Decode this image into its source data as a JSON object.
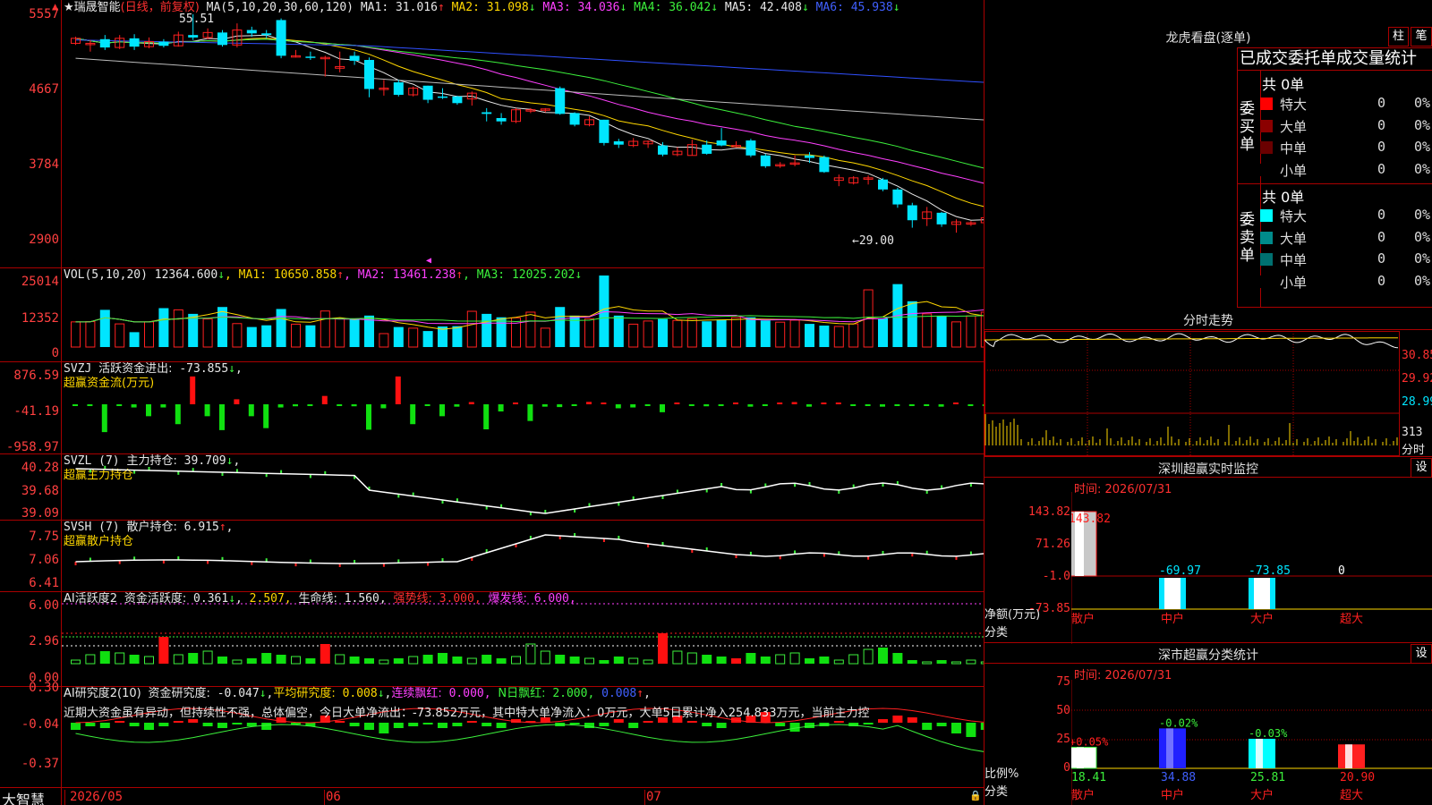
{
  "stock": {
    "name": "★瑞晟智能",
    "period": "(日线，前复权)"
  },
  "main_chart": {
    "ma_label": "MA(5,10,20,30,60,120)",
    "ma": [
      {
        "name": "MA1:",
        "value": "31.016",
        "arrow": "↑",
        "color": "#e8e8e8"
      },
      {
        "name": "MA2:",
        "value": "31.098",
        "arrow": "↓",
        "color": "#ffd700"
      },
      {
        "name": "MA3:",
        "value": "34.036",
        "arrow": "↓",
        "color": "#ff40ff"
      },
      {
        "name": "MA4:",
        "value": "36.042",
        "arrow": "↓",
        "color": "#3cf13c"
      },
      {
        "name": "MA5:",
        "value": "42.408",
        "arrow": "↓",
        "color": "#e8e8e8"
      },
      {
        "name": "MA6:",
        "value": "45.938",
        "arrow": "↓",
        "color": "#4060ff"
      }
    ],
    "y_labels": [
      "5557",
      "4667",
      "3784",
      "2900"
    ],
    "high_marker": "55.51",
    "low_marker": "←29.00",
    "candles": [
      [
        52.0,
        52.6,
        51.8,
        52.8,
        1
      ],
      [
        52.0,
        52.0,
        51.0,
        52.4,
        1
      ],
      [
        52.5,
        51.5,
        51.2,
        53.0,
        0
      ],
      [
        51.5,
        52.6,
        51.3,
        53.0,
        1
      ],
      [
        52.6,
        51.6,
        51.2,
        53.1,
        0
      ],
      [
        51.6,
        52.2,
        51.4,
        52.7,
        1
      ],
      [
        52.2,
        51.7,
        51.5,
        52.5,
        0
      ],
      [
        51.7,
        53.0,
        51.6,
        53.4,
        1
      ],
      [
        53.0,
        52.7,
        52.4,
        55.5,
        0
      ],
      [
        52.7,
        53.3,
        52.5,
        53.8,
        1
      ],
      [
        53.3,
        51.8,
        51.6,
        53.6,
        0
      ],
      [
        51.8,
        53.6,
        51.5,
        54.4,
        1
      ],
      [
        53.6,
        53.2,
        52.8,
        54.0,
        0
      ],
      [
        53.2,
        53.0,
        52.6,
        53.6,
        0
      ],
      [
        54.8,
        50.5,
        50.2,
        55.0,
        0
      ],
      [
        50.5,
        50.5,
        50.3,
        51.2,
        1
      ],
      [
        50.4,
        50.3,
        50.0,
        51.0,
        0
      ],
      [
        50.3,
        50.3,
        48.0,
        50.5,
        1
      ],
      [
        49.2,
        49.0,
        48.5,
        51.0,
        1
      ],
      [
        50.5,
        49.9,
        49.4,
        51.0,
        0
      ],
      [
        50.0,
        46.5,
        45.5,
        50.3,
        0
      ],
      [
        46.5,
        46.6,
        45.7,
        47.6,
        1
      ],
      [
        47.3,
        45.8,
        45.6,
        47.6,
        0
      ],
      [
        45.8,
        46.6,
        45.6,
        46.8,
        1
      ],
      [
        46.9,
        45.2,
        44.8,
        46.9,
        0
      ],
      [
        45.6,
        45.6,
        45.3,
        46.6,
        0
      ],
      [
        45.6,
        44.8,
        44.6,
        45.7,
        0
      ],
      [
        45.3,
        46.0,
        44.5,
        46.2,
        1
      ],
      [
        43.5,
        43.7,
        42.6,
        44.2,
        0
      ],
      [
        43.0,
        42.6,
        42.2,
        43.6,
        0
      ],
      [
        42.6,
        44.0,
        42.4,
        44.2,
        1
      ],
      [
        44.0,
        44.0,
        43.6,
        44.2,
        1
      ],
      [
        44.0,
        44.1,
        43.7,
        44.2,
        1
      ],
      [
        46.6,
        43.5,
        43.4,
        46.8,
        0
      ],
      [
        43.6,
        42.2,
        42.0,
        43.7,
        0
      ],
      [
        42.2,
        42.8,
        42.0,
        43.2,
        1
      ],
      [
        42.8,
        40.0,
        39.7,
        42.8,
        0
      ],
      [
        40.2,
        39.8,
        39.4,
        40.5,
        0
      ],
      [
        39.7,
        40.2,
        39.5,
        40.6,
        1
      ],
      [
        40.2,
        39.9,
        39.4,
        40.3,
        1
      ],
      [
        39.7,
        38.6,
        38.4,
        40.1,
        0
      ],
      [
        38.6,
        39.0,
        38.4,
        39.5,
        1
      ],
      [
        38.5,
        39.8,
        38.5,
        40.4,
        1
      ],
      [
        39.8,
        38.7,
        38.6,
        40.3,
        0
      ],
      [
        40.3,
        39.7,
        39.6,
        41.8,
        0
      ],
      [
        39.7,
        39.6,
        39.5,
        40.2,
        1
      ],
      [
        40.3,
        38.5,
        38.3,
        40.5,
        0
      ],
      [
        38.5,
        37.2,
        37.0,
        38.7,
        0
      ],
      [
        37.3,
        37.4,
        37.0,
        37.7,
        1
      ],
      [
        37.5,
        37.6,
        37.2,
        38.5,
        1
      ],
      [
        38.5,
        38.2,
        37.6,
        38.9,
        0
      ],
      [
        38.3,
        36.5,
        36.4,
        38.5,
        0
      ],
      [
        35.8,
        35.5,
        34.8,
        36.2,
        1
      ],
      [
        35.2,
        35.8,
        35.0,
        36.0,
        1
      ],
      [
        35.8,
        35.7,
        35.0,
        36.1,
        1
      ],
      [
        35.6,
        34.4,
        34.2,
        35.8,
        0
      ],
      [
        34.4,
        32.6,
        32.2,
        34.6,
        0
      ],
      [
        32.5,
        30.7,
        29.8,
        32.8,
        0
      ],
      [
        30.9,
        31.7,
        30.0,
        32.3,
        1
      ],
      [
        31.6,
        30.2,
        29.9,
        31.7,
        0
      ],
      [
        30.2,
        30.5,
        29.2,
        30.8,
        1
      ],
      [
        30.4,
        30.4,
        30.0,
        30.6,
        1
      ],
      [
        30.4,
        31.0,
        30.2,
        31.3,
        1
      ],
      [
        31.0,
        30.7,
        30.4,
        31.1,
        1
      ],
      [
        30.7,
        30.8,
        30.5,
        32.3,
        0
      ],
      [
        30.8,
        31.0,
        30.4,
        31.3,
        1
      ],
      [
        30.8,
        30.6,
        30.4,
        31.1,
        1
      ],
      [
        30.6,
        29.8,
        29.4,
        30.8,
        0
      ],
      [
        30.3,
        31.4,
        30.2,
        31.6,
        0
      ]
    ]
  },
  "vol_panel": {
    "label": "VOL(5,10,20)",
    "value": "12364.600",
    "value_arrow": "↓",
    "ma": [
      {
        "name": "MA1:",
        "value": "10650.858",
        "arrow": "↑",
        "color": "#ffd700"
      },
      {
        "name": "MA2:",
        "value": "13461.238",
        "arrow": "↑",
        "color": "#ff40ff"
      },
      {
        "name": "MA3:",
        "value": "12025.202",
        "arrow": "↓",
        "color": "#3cf13c"
      }
    ],
    "y_labels": [
      "25014",
      "12352",
      "0"
    ],
    "volumes": [
      8800,
      8900,
      13000,
      8100,
      5200,
      8800,
      13600,
      13000,
      11600,
      9800,
      14000,
      8200,
      7000,
      7600,
      13300,
      8000,
      7600,
      12600,
      9900,
      10000,
      11000,
      4700,
      7000,
      6600,
      5600,
      7200,
      7300,
      12500,
      11600,
      10400,
      10200,
      12200,
      6600,
      14000,
      11000,
      9900,
      25000,
      11000,
      8000,
      9100,
      9800,
      9300,
      9900,
      9000,
      9600,
      10300,
      10400,
      9300,
      8700,
      9400,
      8100,
      7500,
      7200,
      8100,
      20000,
      10000,
      22000,
      16000,
      11600,
      10800,
      8800,
      10900,
      12200,
      9600,
      8100,
      10900,
      12300,
      11000,
      8000
    ]
  },
  "svzj_panel": {
    "label": "SVZJ",
    "name": "活跃资金进出:",
    "value": "-73.855",
    "arrow": "↓",
    "subtitle": "超赢资金流(万元)",
    "y_labels": [
      "876.59",
      "-41.19",
      "-958.97"
    ],
    "values": [
      -20,
      -30,
      -700,
      -20,
      -80,
      -300,
      -80,
      -500,
      -550,
      -300,
      -650,
      -180,
      -300,
      -600,
      -80,
      -50,
      -30,
      -300,
      -30,
      -50,
      -640,
      -100,
      -30,
      -500,
      -30,
      -300,
      -60,
      -80,
      -630,
      -180,
      -40,
      -420,
      -60,
      -70,
      -40,
      -30,
      -20,
      -100,
      -80,
      -20,
      -200,
      -30,
      -20,
      -50,
      -40,
      -20,
      -60,
      -40,
      -30,
      -80,
      -60,
      -30,
      -40,
      -30,
      -20,
      -60,
      -30,
      -40,
      -20,
      -60,
      -30,
      -40,
      -20,
      -30,
      -20,
      -30,
      -50,
      -20,
      -60
    ],
    "pos": [
      0,
      0,
      0,
      0,
      0,
      0,
      0,
      0,
      0,
      0,
      0,
      0,
      0,
      0,
      0,
      0,
      0,
      750,
      0,
      0,
      0,
      0,
      0,
      0,
      0,
      0,
      0,
      0,
      0,
      0,
      0,
      0,
      0,
      0,
      0,
      0,
      0,
      0,
      0,
      0,
      0,
      0,
      0,
      0,
      0,
      0,
      0,
      0,
      0,
      0,
      0,
      0,
      0,
      0,
      0,
      0,
      0,
      0,
      0,
      0,
      0,
      0,
      0,
      0,
      0,
      0,
      0,
      0,
      0
    ]
  },
  "svzl_panel": {
    "label": "SVZL (7)",
    "name": "主力持仓:",
    "value": "39.709",
    "arrow": "↓",
    "subtitle": "超赢主力持仓",
    "y_labels": [
      "40.28",
      "39.68",
      "39.09"
    ]
  },
  "svsh_panel": {
    "label": "SVSH (7)",
    "name": "散户持仓:",
    "value": "6.915",
    "arrow": "↑",
    "subtitle": "超赢散户持仓",
    "y_labels": [
      "7.75",
      "7.06",
      "6.41"
    ]
  },
  "ai_active_panel": {
    "label": "AI活跃度2",
    "name": "资金活跃度:",
    "value": "0.361",
    "arrow": "↓",
    "value2": "2.507,",
    "life_label": "生命线:",
    "life_value": "1.560,",
    "strong_label": "强势线:",
    "strong_value": "3.000,",
    "burst_label": "爆发线:",
    "burst_value": "6.000,",
    "y_labels": [
      "6.00",
      "2.96",
      "0.00"
    ]
  },
  "ai_research_panel": {
    "label": "AI研究度2(10)",
    "name": "资金研究度:",
    "value": "-0.047",
    "arrow": "↓",
    "avg_label": "平均研究度:",
    "avg_value": "0.008",
    "avg_arrow": "↓",
    "red_label": "连续飘红:",
    "red_value": "0.000,",
    "nred_label": "N日飘红:",
    "nred_value": "2.000,",
    "extra": "0.008",
    "y_labels": [
      "0.30",
      "-0.04",
      "-0.37"
    ],
    "comment": "近期大资金虽有异动，但持续性不强，总体偏空，今日大单净流出：-73.852万元，其中特大单净流入：0万元，大单5日累计净入254.833万元，当前主力控"
  },
  "x_axis": {
    "logo": "大智慧",
    "labels": [
      "2026/05",
      "06",
      "07"
    ]
  },
  "dragon": {
    "title": "龙虎看盘(逐单)",
    "btn1": "柱",
    "btn2": "笔",
    "tabs_text": "已成交委托单成交量统计",
    "buy": {
      "side_label": "委买单",
      "count": "共 0单",
      "rows": [
        {
          "label": "特大",
          "num": "0",
          "pct": "0%",
          "color": "#ff0000"
        },
        {
          "label": "大单",
          "num": "0",
          "pct": "0%",
          "color": "#8b0000"
        },
        {
          "label": "中单",
          "num": "0",
          "pct": "0%",
          "color": "#6a0000"
        },
        {
          "label": "小单",
          "num": "0",
          "pct": "0%",
          "color": "#000000"
        }
      ]
    },
    "sell": {
      "side_label": "委卖单",
      "count": "共 0单",
      "rows": [
        {
          "label": "特大",
          "num": "0",
          "pct": "0%",
          "color": "#00ffff"
        },
        {
          "label": "大单",
          "num": "0",
          "pct": "0%",
          "color": "#008b8b"
        },
        {
          "label": "中单",
          "num": "0",
          "pct": "0%",
          "color": "#007070"
        },
        {
          "label": "小单",
          "num": "0",
          "pct": "0%",
          "color": "#000000"
        }
      ]
    }
  },
  "intraday": {
    "title": "分时走势",
    "right_labels": [
      "30.85",
      "29.92",
      "28.99",
      "313",
      "分时"
    ]
  },
  "sz_monitor": {
    "title": "深圳超赢实时监控",
    "set": "设",
    "time": "时间: 2026/07/31",
    "y_labels": [
      "143.82",
      "71.26",
      "-1.0",
      "-73.85"
    ],
    "unit": "净额(万元)",
    "cat_label": "分类",
    "chart_data": {
      "type": "bar",
      "categories": [
        "散户",
        "中户",
        "大户",
        "超大"
      ],
      "values": [
        143.82,
        -69.97,
        -73.85,
        0
      ],
      "labels": [
        "143.82",
        "-69.97",
        "-73.85",
        "0"
      ]
    }
  },
  "sz_class": {
    "title": "深市超赢分类统计",
    "set": "设",
    "time": "时间: 2026/07/31",
    "y_labels": [
      "75",
      "50",
      "25",
      "0"
    ],
    "unit": "比例%",
    "cat_label": "分类",
    "chart_data": {
      "type": "bar",
      "categories": [
        "散户",
        "中户",
        "大户",
        "超大"
      ],
      "values": [
        18.41,
        34.88,
        25.81,
        20.9
      ],
      "changes": [
        "+0.05%",
        "-0.02%",
        "-0.03%",
        ""
      ],
      "colors": [
        "#ffffff",
        "#2020ff",
        "#00ffff",
        "#ff2020"
      ]
    }
  }
}
